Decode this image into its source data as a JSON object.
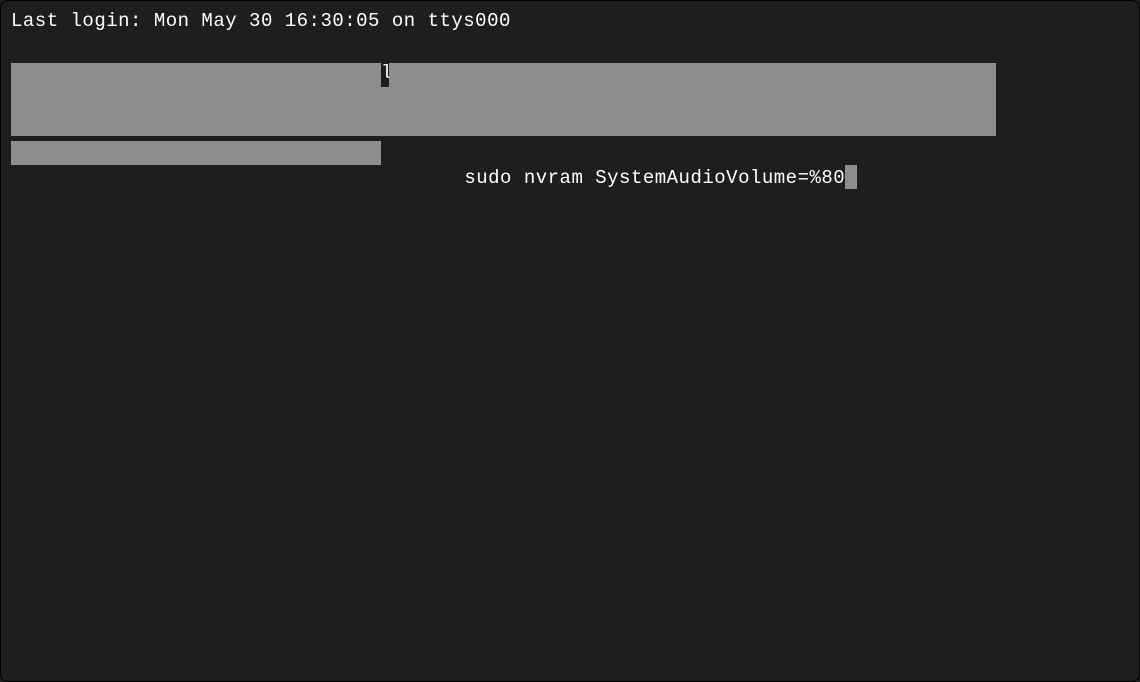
{
  "terminal": {
    "last_login_line": "Last login: Mon May 30 16:30:05 on ttys000",
    "command": " sudo nvram SystemAudioVolume=%80"
  }
}
